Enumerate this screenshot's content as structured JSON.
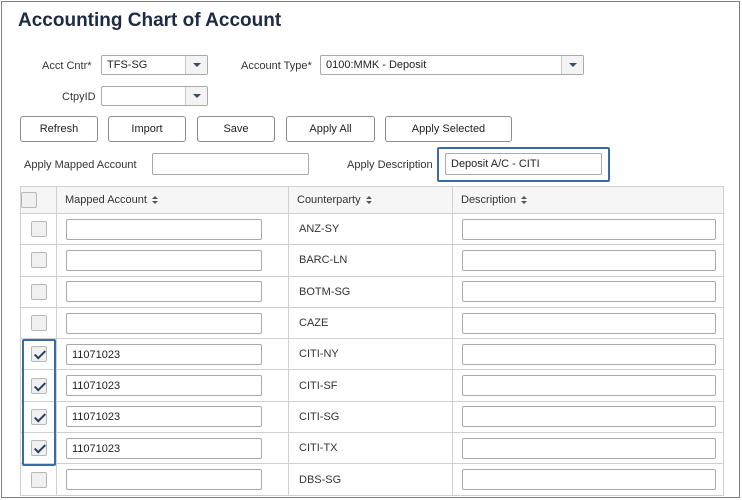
{
  "page_title": "Accounting Chart of Account",
  "filters": {
    "acct_cntr_label": "Acct Cntr*",
    "acct_cntr_value": "TFS-SG",
    "account_type_label": "Account Type*",
    "account_type_value": "0100:MMK - Deposit",
    "ctpyid_label": "CtpyID",
    "ctpyid_value": ""
  },
  "toolbar": {
    "refresh": "Refresh",
    "import": "Import",
    "save": "Save",
    "apply_all": "Apply All",
    "apply_selected": "Apply Selected"
  },
  "apply": {
    "mapped_account_label": "Apply Mapped Account",
    "mapped_account_value": "",
    "description_label": "Apply Description",
    "description_value": "Deposit A/C - CITI"
  },
  "table": {
    "headers": {
      "mapped_account": "Mapped Account",
      "counterparty": "Counterparty",
      "description": "Description"
    },
    "rows": [
      {
        "checked": false,
        "mapped_account": "",
        "counterparty": "ANZ-SY",
        "description": ""
      },
      {
        "checked": false,
        "mapped_account": "",
        "counterparty": "BARC-LN",
        "description": ""
      },
      {
        "checked": false,
        "mapped_account": "",
        "counterparty": "BOTM-SG",
        "description": ""
      },
      {
        "checked": false,
        "mapped_account": "",
        "counterparty": "CAZE",
        "description": ""
      },
      {
        "checked": true,
        "mapped_account": "11071023",
        "counterparty": "CITI-NY",
        "description": ""
      },
      {
        "checked": true,
        "mapped_account": "11071023",
        "counterparty": "CITI-SF",
        "description": ""
      },
      {
        "checked": true,
        "mapped_account": "11071023",
        "counterparty": "CITI-SG",
        "description": ""
      },
      {
        "checked": true,
        "mapped_account": "11071023",
        "counterparty": "CITI-TX",
        "description": ""
      },
      {
        "checked": false,
        "mapped_account": "",
        "counterparty": "DBS-SG",
        "description": ""
      }
    ]
  },
  "colors": {
    "highlight": "#3b6aa8",
    "check": "#2c3e66"
  }
}
